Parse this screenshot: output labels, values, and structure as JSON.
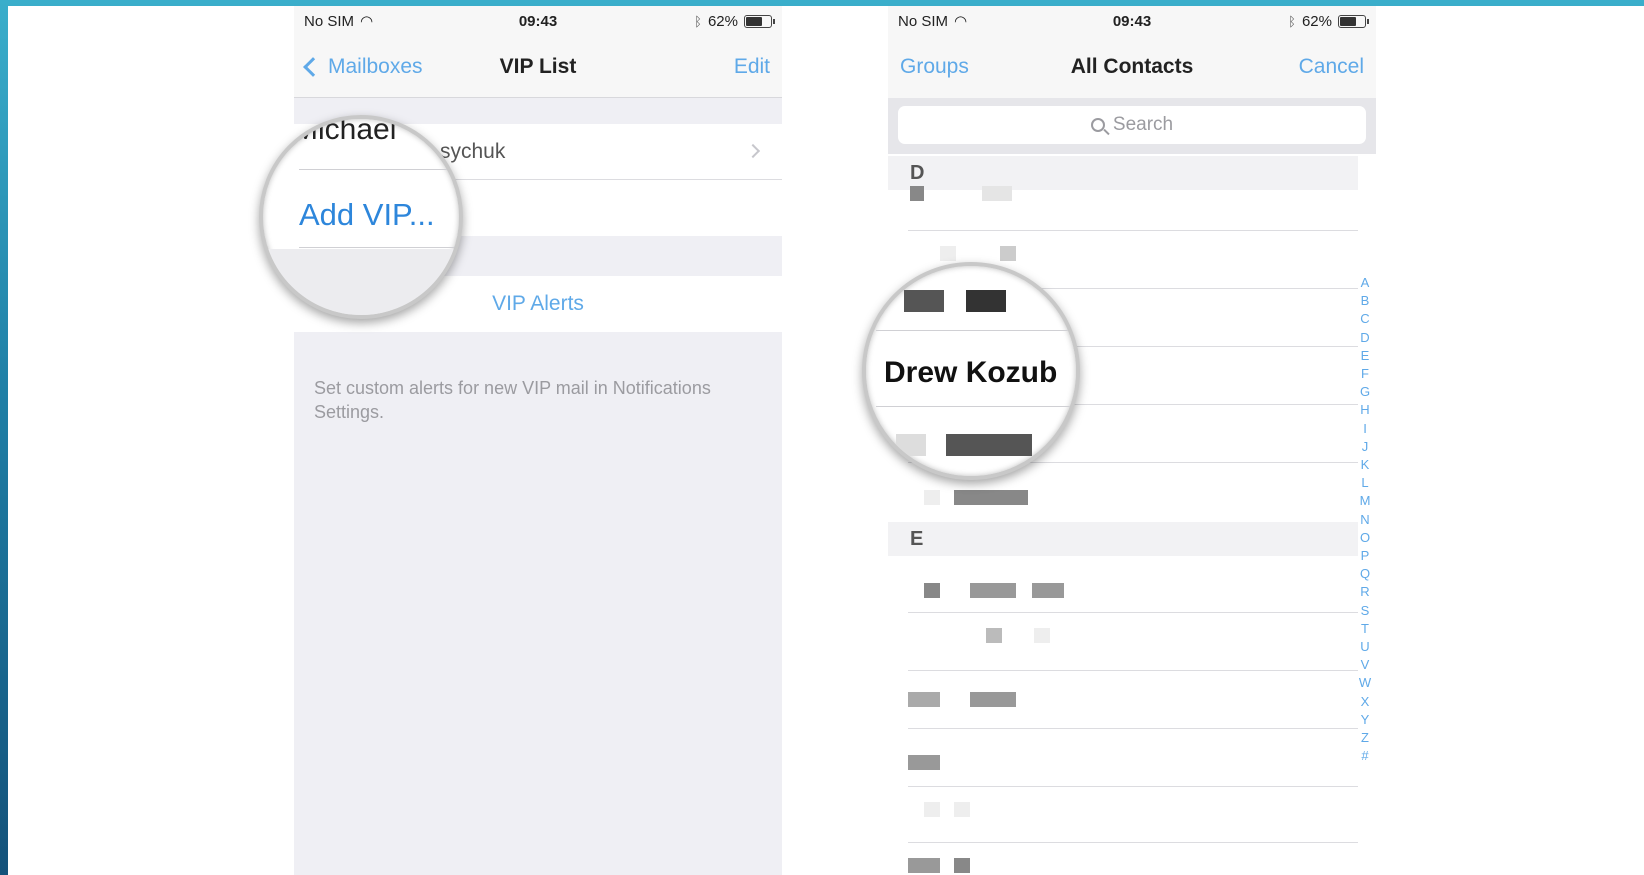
{
  "status_bar": {
    "carrier": "No SIM",
    "time": "09:43",
    "battery": "62%"
  },
  "left_screen": {
    "nav": {
      "back_label": "Mailboxes",
      "title": "VIP List",
      "edit_label": "Edit"
    },
    "vip_entry_name": "sychuk",
    "vip_alerts_label": "VIP Alerts",
    "footer_note": "Set custom alerts for new VIP mail in Notifications Settings.",
    "magnifier": {
      "name_fragment": "Michael",
      "add_vip_label": "Add VIP..."
    }
  },
  "right_screen": {
    "nav": {
      "groups_label": "Groups",
      "title": "All Contacts",
      "cancel_label": "Cancel"
    },
    "search_placeholder": "Search",
    "sections": [
      "D",
      "E"
    ],
    "magnifier": {
      "contact_name": "Drew Kozub"
    },
    "index_letters": [
      "A",
      "B",
      "C",
      "D",
      "E",
      "F",
      "G",
      "H",
      "I",
      "J",
      "K",
      "L",
      "M",
      "N",
      "O",
      "P",
      "Q",
      "R",
      "S",
      "T",
      "U",
      "V",
      "W",
      "X",
      "Y",
      "Z",
      "#"
    ]
  },
  "colors": {
    "ios_blue": "#5fa9e8",
    "link_blue": "#2d86db",
    "background": "#efeff4"
  }
}
